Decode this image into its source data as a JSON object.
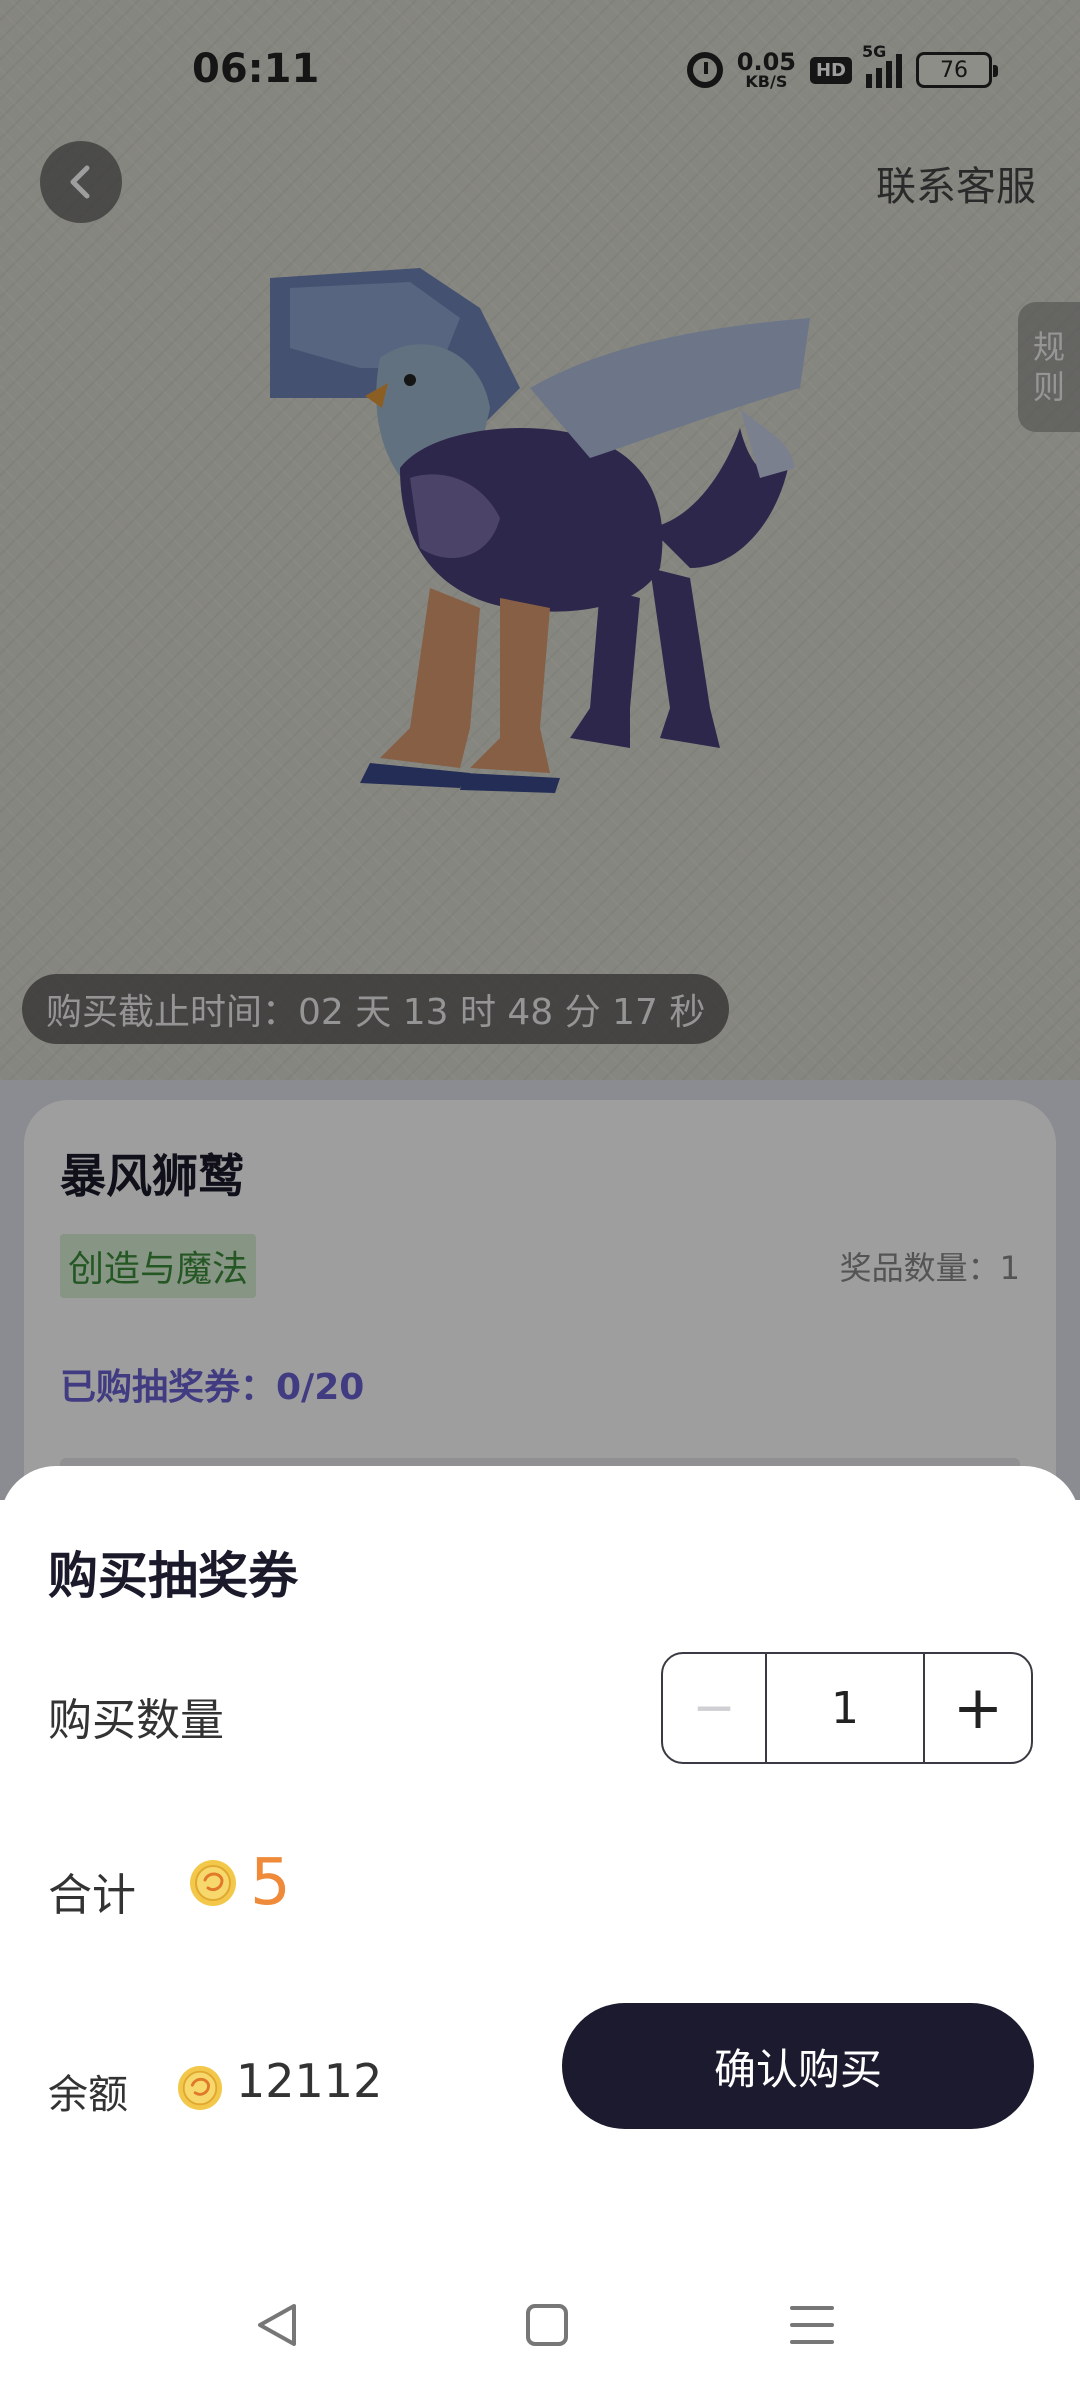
{
  "status_bar": {
    "time": "06:11",
    "net_speed_value": "0.05",
    "net_speed_unit": "KB/S",
    "hd_label": "HD",
    "network_label": "5G",
    "battery": "76",
    "icons": [
      "alarm-icon",
      "hd-icon",
      "signal-icon",
      "battery-icon"
    ]
  },
  "header": {
    "back_icon": "chevron-left-icon",
    "support_label": "联系客服",
    "rules_label": [
      "规",
      "则"
    ]
  },
  "prize": {
    "image_subject": "griffin",
    "deadline": "购买截止时间：02 天 13 时 48 分 17 秒",
    "name": "暴风狮鹫",
    "category": "创造与魔法",
    "quantity_text": "奖品数量：1",
    "tickets_text": "已购抽奖券：0/20",
    "tickets_progress": 0
  },
  "purchase_sheet": {
    "title": "购买抽奖券",
    "quantity_label": "购买数量",
    "minus_label": "−",
    "quantity_value": "1",
    "plus_label": "+",
    "total_label": "合计",
    "total_value": "5",
    "balance_label": "余额",
    "balance_value": "12112",
    "confirm_label": "确认购买",
    "coin_icon": "coin-icon"
  },
  "colors": {
    "accent_purple": "#6a5fd0",
    "price_orange": "#ee8a3a",
    "button_dark": "#1b1a2e",
    "tag_green": "#3c8d3a"
  },
  "nav_bar": [
    "back-triangle-icon",
    "home-square-icon",
    "menu-lines-icon"
  ]
}
